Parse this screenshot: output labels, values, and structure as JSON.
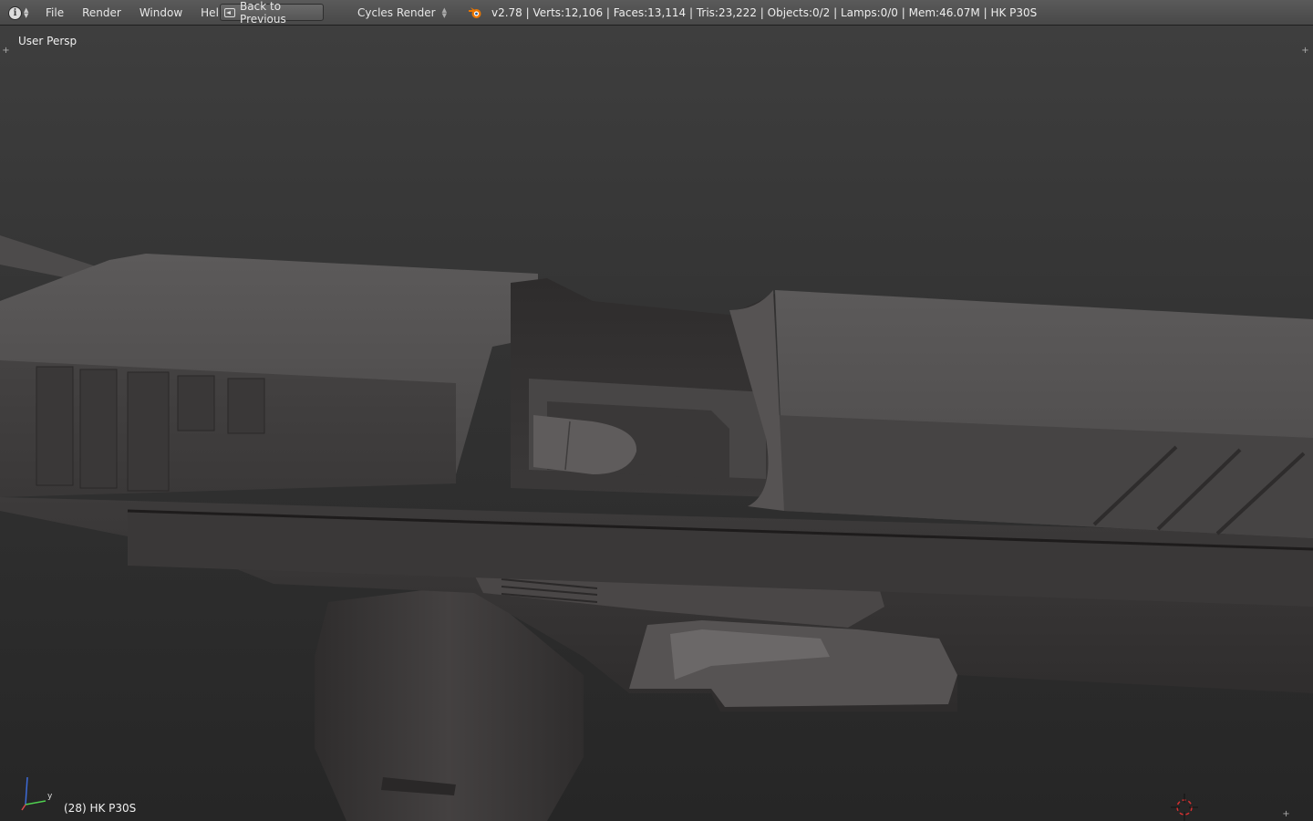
{
  "header": {
    "editor_icon": "info-icon",
    "menu": [
      "File",
      "Render",
      "Window",
      "Help"
    ],
    "back_button": "Back to Previous",
    "render_engine": "Cycles Render",
    "stats": "v2.78 | Verts:12,106 | Faces:13,114 | Tris:23,222 | Objects:0/2 | Lamps:0/0 | Mem:46.07M | HK P30S"
  },
  "viewport": {
    "view_name": "User Persp",
    "object_label": "(28) HK P30S",
    "gizmo_axes": {
      "y": "y"
    }
  },
  "colors": {
    "header_bg": "#4f4f4f",
    "viewport_top": "#3e3e3e",
    "viewport_bottom": "#262626",
    "model_body": "#454444"
  }
}
